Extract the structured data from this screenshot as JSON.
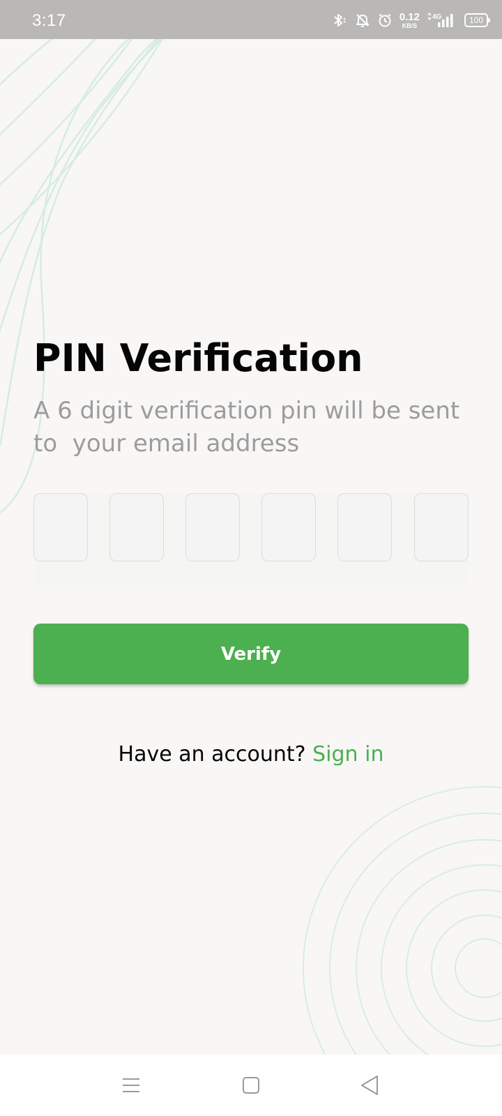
{
  "status_bar": {
    "time": "3:17",
    "net_speed_value": "0.12",
    "net_speed_unit": "KB/S",
    "network_type": "4G",
    "battery": "100",
    "icons": [
      "bluetooth-icon",
      "bell-muted-icon",
      "alarm-icon",
      "signal-icon",
      "battery-icon"
    ]
  },
  "main": {
    "title": "PIN Verification",
    "subtitle": "A 6 digit verification pin will be sent to  your email address",
    "pin_boxes": [
      "",
      "",
      "",
      "",
      "",
      ""
    ],
    "verify_label": "Verify",
    "account_prompt": "Have an account? ",
    "signin_label": "Sign in"
  },
  "colors": {
    "accent": "#4caf50",
    "background": "#f8f7f6",
    "status_bar": "#b9b8b7",
    "decor_lines": "#d3ebdf"
  },
  "nav_bar": {
    "icons": [
      "menu-icon",
      "home-square-icon",
      "back-triangle-icon"
    ]
  }
}
